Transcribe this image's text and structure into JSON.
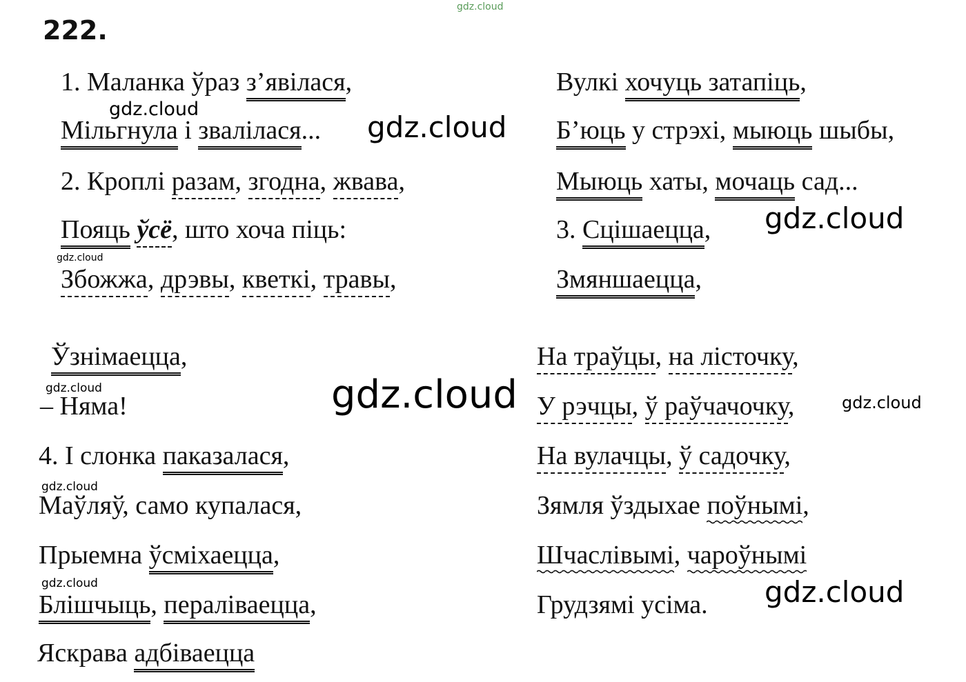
{
  "exercise_number": "222.",
  "watermark": "gdz.cloud",
  "left_top": {
    "l1": [
      "1. Маланка ўраз ",
      "з’явілася",
      ","
    ],
    "l2": [
      "Мільгнула",
      " і ",
      "звалілася",
      "..."
    ],
    "l3": [
      "2. Кроплі ",
      "разам",
      ", ",
      "згодна",
      ", ",
      "жвава",
      ","
    ],
    "l4": [
      "Пояць",
      " ",
      "ўсё",
      ", што хоча піць:"
    ],
    "l5": [
      "Збожжа",
      ", ",
      "дрэвы",
      ", ",
      "кветкі",
      ", ",
      "травы",
      ","
    ]
  },
  "right_top": {
    "l1": [
      "Вулкі ",
      "хочуць затапіць",
      ","
    ],
    "l2": [
      "Б’юць",
      " у стрэхі, ",
      "мыюць",
      " шыбы,"
    ],
    "l3": [
      "Мыюць",
      " хаты, ",
      "мочаць",
      " сад..."
    ],
    "l4": [
      "3. ",
      "Сцішаецца",
      ","
    ],
    "l5": [
      "Змяншаецца",
      ","
    ]
  },
  "left_bottom": {
    "l1": [
      "Ўзнімаецца",
      ","
    ],
    "l2": [
      "– Няма!"
    ],
    "l3": [
      "4. І слонка ",
      "паказалася",
      ","
    ],
    "l4": [
      "Маўляў, само купалася,"
    ],
    "l5": [
      "Прыемна ",
      "ўсміхаецца",
      ","
    ],
    "l6": [
      "Блішчыць",
      ", ",
      "пераліваецца",
      ","
    ],
    "l7": [
      "Яскрава ",
      "адбіваецца"
    ]
  },
  "right_bottom": {
    "l1": [
      "На траўцы",
      ", ",
      "на лісточку",
      ","
    ],
    "l2": [
      "У рэчцы",
      ", ",
      "ў раўчачочку",
      ","
    ],
    "l3": [
      "На вулачцы",
      ", ",
      "ў садочку",
      ","
    ],
    "l4": [
      "Зямля ўздыхае ",
      "поўнымі",
      ","
    ],
    "l5": [
      "Шчаслівымі",
      ", ",
      "чароўнымі"
    ],
    "l6": [
      "Грудзямі усіма."
    ]
  }
}
